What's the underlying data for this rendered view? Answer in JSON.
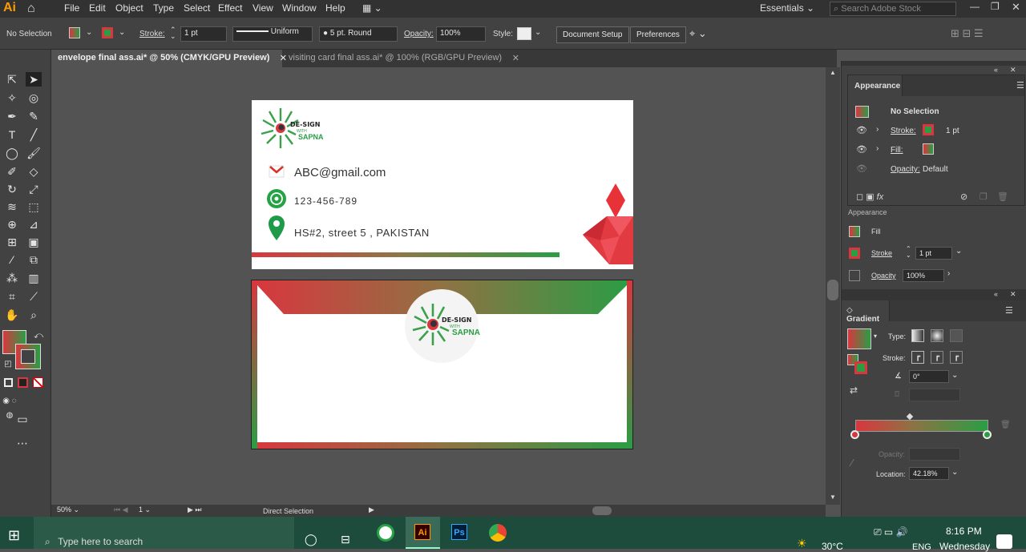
{
  "app": {
    "logo": "Ai"
  },
  "menu": [
    "File",
    "Edit",
    "Object",
    "Type",
    "Select",
    "Effect",
    "View",
    "Window",
    "Help"
  ],
  "workspace": {
    "label": "Essentials",
    "search_placeholder": "Search Adobe Stock"
  },
  "control": {
    "selection": "No Selection",
    "stroke_label": "Stroke:",
    "stroke_value": "1 pt",
    "profile": "Uniform",
    "brush": "5 pt. Round",
    "opacity_label": "Opacity:",
    "opacity_value": "100%",
    "style_label": "Style:",
    "doc_setup": "Document Setup",
    "preferences": "Preferences"
  },
  "tabs": [
    {
      "label": "envelope final ass.ai* @ 50% (CMYK/GPU Preview)",
      "active": true
    },
    {
      "label": "visiting card final ass.ai* @ 100% (RGB/GPU Preview)",
      "active": false
    }
  ],
  "card": {
    "brand_top": "DE-SIGN",
    "brand_mid": "WITH",
    "brand_bottom": "SAPNA",
    "email": "ABC@gmail.com",
    "phone": "123-456-789",
    "address": "HS#2, street 5 , PAKISTAN"
  },
  "envelope": {
    "brand_top": "DE-SIGN",
    "brand_mid": "WITH",
    "brand_bottom": "SAPNA"
  },
  "status": {
    "zoom": "50%",
    "artboard": "1",
    "tool": "Direct Selection"
  },
  "appearance_panel": {
    "tab": "Appearance",
    "title": "No Selection",
    "stroke_label": "Stroke:",
    "stroke_value": "1 pt",
    "fill_label": "Fill:",
    "opacity_label": "Opacity:",
    "opacity_value": "Default"
  },
  "appearance_props": {
    "header": "Appearance",
    "fill": "Fill",
    "stroke": "Stroke",
    "stroke_value": "1 pt",
    "opacity": "Opacity",
    "opacity_value": "100%"
  },
  "gradient_panel": {
    "tab": "Gradient",
    "type_label": "Type:",
    "stroke_label": "Stroke:",
    "angle": "0°",
    "opacity_label": "Opacity:",
    "location_label": "Location:",
    "location_value": "42.18%"
  },
  "taskbar": {
    "search": "Type here to search",
    "temp": "30°C",
    "lang": "ENG",
    "time": "8:16 PM",
    "day": "Wednesday"
  },
  "colors": {
    "grad_red": "#d9363e",
    "grad_green": "#2a9d45",
    "accent": "#ff9a00"
  }
}
